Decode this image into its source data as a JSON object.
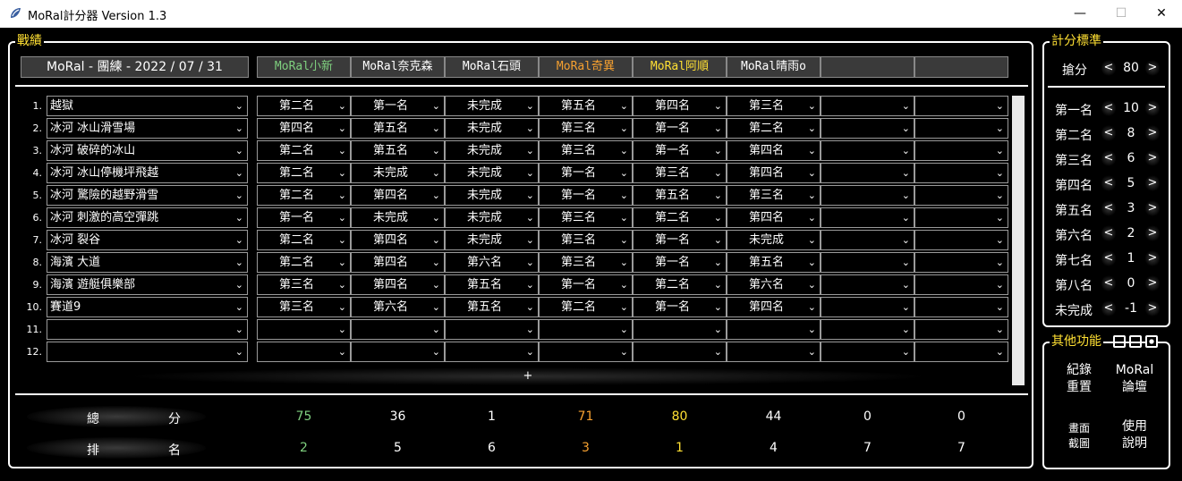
{
  "window": {
    "title": "MoRal計分器 Version 1.3",
    "minimize": "—",
    "maximize": "☐",
    "close": "✕"
  },
  "record": {
    "section_title": "戰績",
    "date_label": "MoRal - 團練 - 2022 / 07 / 31",
    "players": [
      {
        "name": "MoRal小新",
        "color": "#7fd07f"
      },
      {
        "name": "MoRal奈克森",
        "color": "#ffffff"
      },
      {
        "name": "MoRal石頭",
        "color": "#ffffff"
      },
      {
        "name": "MoRal奇異",
        "color": "#f5a030"
      },
      {
        "name": "MoRal阿順",
        "color": "#ffe033"
      },
      {
        "name": "MoRal晴雨o",
        "color": "#ffffff"
      },
      {
        "name": "",
        "color": "#ffffff"
      },
      {
        "name": "",
        "color": "#ffffff"
      }
    ],
    "rows": [
      {
        "num": "1.",
        "course": "越獄",
        "ranks": [
          "第二名",
          "第一名",
          "未完成",
          "第五名",
          "第四名",
          "第三名",
          "",
          ""
        ]
      },
      {
        "num": "2.",
        "course": "冰河 冰山滑雪場",
        "ranks": [
          "第四名",
          "第五名",
          "未完成",
          "第三名",
          "第一名",
          "第二名",
          "",
          ""
        ]
      },
      {
        "num": "3.",
        "course": "冰河 破碎的冰山",
        "ranks": [
          "第二名",
          "第五名",
          "未完成",
          "第三名",
          "第一名",
          "第四名",
          "",
          ""
        ]
      },
      {
        "num": "4.",
        "course": "冰河 冰山停機坪飛越",
        "ranks": [
          "第二名",
          "未完成",
          "未完成",
          "第一名",
          "第三名",
          "第四名",
          "",
          ""
        ]
      },
      {
        "num": "5.",
        "course": "冰河 驚險的越野滑雪",
        "ranks": [
          "第二名",
          "第四名",
          "未完成",
          "第一名",
          "第五名",
          "第三名",
          "",
          ""
        ]
      },
      {
        "num": "6.",
        "course": "冰河 刺激的高空彈跳",
        "ranks": [
          "第一名",
          "未完成",
          "未完成",
          "第三名",
          "第二名",
          "第四名",
          "",
          ""
        ]
      },
      {
        "num": "7.",
        "course": "冰河 裂谷",
        "ranks": [
          "第二名",
          "第四名",
          "未完成",
          "第三名",
          "第一名",
          "未完成",
          "",
          ""
        ]
      },
      {
        "num": "8.",
        "course": "海濱 大道",
        "ranks": [
          "第二名",
          "第四名",
          "第六名",
          "第三名",
          "第一名",
          "第五名",
          "",
          ""
        ]
      },
      {
        "num": "9.",
        "course": "海濱 遊艇俱樂部",
        "ranks": [
          "第三名",
          "第四名",
          "第五名",
          "第一名",
          "第二名",
          "第六名",
          "",
          ""
        ]
      },
      {
        "num": "10.",
        "course": "賽道9",
        "ranks": [
          "第三名",
          "第六名",
          "第五名",
          "第二名",
          "第一名",
          "第四名",
          "",
          ""
        ]
      },
      {
        "num": "11.",
        "course": "",
        "ranks": [
          "",
          "",
          "",
          "",
          "",
          "",
          "",
          ""
        ]
      },
      {
        "num": "12.",
        "course": "",
        "ranks": [
          "",
          "",
          "",
          "",
          "",
          "",
          "",
          ""
        ]
      }
    ],
    "add_row_label": "+",
    "totals_label": [
      "總",
      "分"
    ],
    "ranking_label": [
      "排",
      "名"
    ],
    "totals": [
      "75",
      "36",
      "1",
      "71",
      "80",
      "44",
      "0",
      "0"
    ],
    "rankings": [
      "2",
      "5",
      "6",
      "3",
      "1",
      "4",
      "7",
      "7"
    ]
  },
  "scoring": {
    "section_title": "計分標準",
    "grab": {
      "label": "搶分",
      "value": "80"
    },
    "items": [
      {
        "label": "第一名",
        "value": "10"
      },
      {
        "label": "第二名",
        "value": "8"
      },
      {
        "label": "第三名",
        "value": "6"
      },
      {
        "label": "第四名",
        "value": "5"
      },
      {
        "label": "第五名",
        "value": "3"
      },
      {
        "label": "第六名",
        "value": "2"
      },
      {
        "label": "第七名",
        "value": "1"
      },
      {
        "label": "第八名",
        "value": "0"
      },
      {
        "label": "未完成",
        "value": "-1"
      }
    ],
    "left_arrow": "<",
    "right_arrow": ">"
  },
  "other": {
    "section_title": "其他功能",
    "buttons": [
      {
        "l1": "紀錄",
        "l2": "重置"
      },
      {
        "l1": "MoRal",
        "l2": "論壇"
      },
      {
        "l1": "畫面",
        "l2": "截圖"
      },
      {
        "l1": "使用",
        "l2": "說明"
      }
    ]
  },
  "colors": {
    "accent": "#ffe033",
    "orange": "#f5a030",
    "green": "#7fd07f",
    "bg": "#000000"
  }
}
